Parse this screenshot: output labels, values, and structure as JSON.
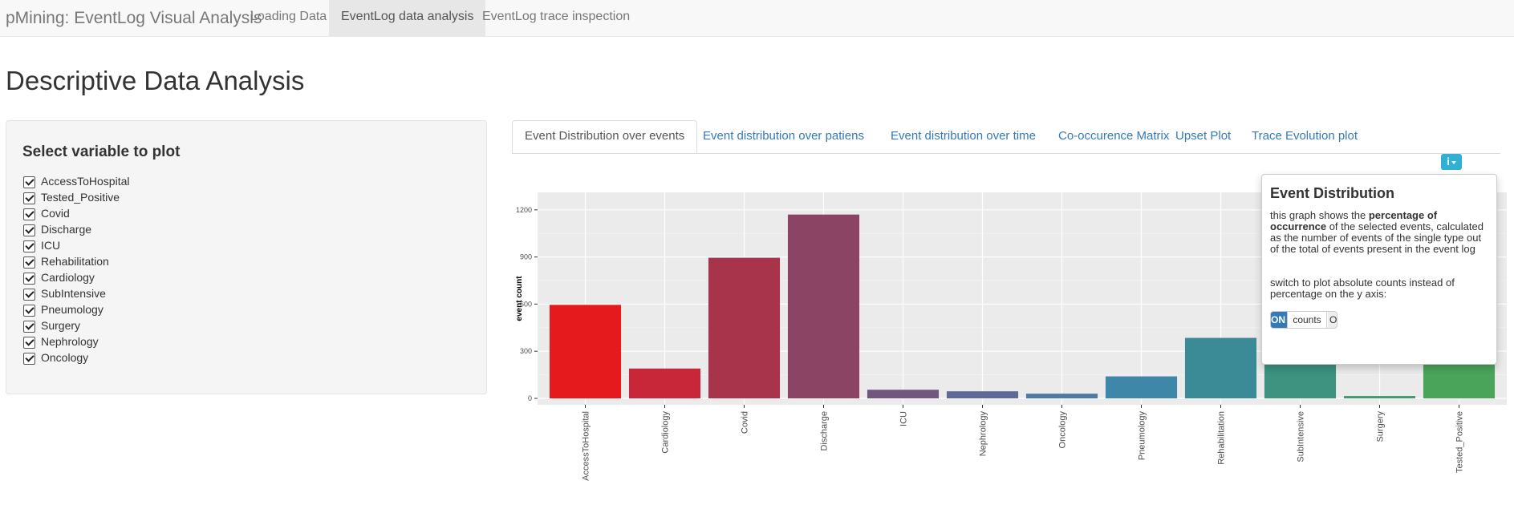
{
  "navbar": {
    "brand": "pMining: EventLog Visual Analysis",
    "items": [
      "Loading Data",
      "EventLog data analysis",
      "EventLog trace inspection"
    ]
  },
  "page_title": "Descriptive Data Analysis",
  "sidebar": {
    "title": "Select variable to plot",
    "checkboxes": [
      "AccessToHospital",
      "Tested_Positive",
      "Covid",
      "Discharge",
      "ICU",
      "Rehabilitation",
      "Cardiology",
      "SubIntensive",
      "Pneumology",
      "Surgery",
      "Nephrology",
      "Oncology"
    ]
  },
  "tabs": [
    "Event Distribution over events",
    "Event distribution over patiens",
    "Event distribution over time",
    "Co-occurence Matrix",
    "Upset Plot",
    "Trace Evolution plot"
  ],
  "popover": {
    "title": "Event Distribution",
    "body_pre": "this graph shows the ",
    "body_bold": "percentage of occurrence",
    "body_post": " of the selected events, calculated as the number of events of the single type out of the total of events present in the event log",
    "body2": "switch to plot absolute counts instead of percentage on the y axis:",
    "switch_on": "ON",
    "switch_label": "counts",
    "switch_off": "O"
  },
  "colors": {
    "panel_bg": "#ebebeb",
    "grid": "#ffffff",
    "link": "#337ab7",
    "info_button": "#31b0d5"
  },
  "chart_data": {
    "type": "bar",
    "title": "",
    "xlabel": "",
    "ylabel": "event count",
    "ylim": [
      0,
      1250
    ],
    "yticks": [
      0,
      300,
      600,
      900,
      1200
    ],
    "grid": true,
    "categories": [
      "AccessToHospital",
      "Cardiology",
      "Covid",
      "Discharge",
      "ICU",
      "Nephrology",
      "Oncology",
      "Pneumology",
      "Rehabilitation",
      "SubIntensive",
      "Surgery",
      "Tested_Positive"
    ],
    "values": [
      595,
      190,
      895,
      1170,
      55,
      45,
      30,
      140,
      385,
      385,
      15,
      385
    ],
    "bar_colors": [
      "#e41a1c",
      "#c8273a",
      "#a8344b",
      "#8c4465",
      "#71567e",
      "#5e6a95",
      "#4f79a0",
      "#3f87a8",
      "#3b8b97",
      "#3d9280",
      "#429a6d",
      "#4aa55b"
    ]
  }
}
